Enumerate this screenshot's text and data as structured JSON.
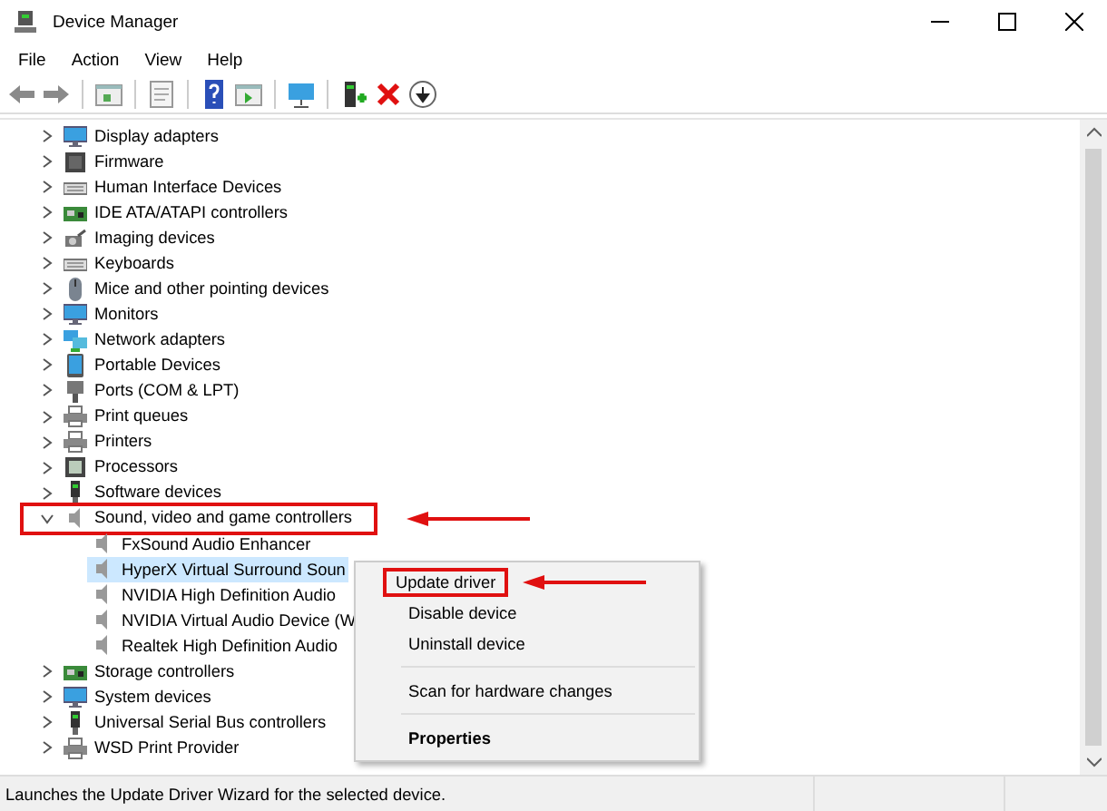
{
  "window": {
    "title": "Device Manager"
  },
  "menu": [
    "File",
    "Action",
    "View",
    "Help"
  ],
  "tree": [
    {
      "label": "Display adapters",
      "expanded": false
    },
    {
      "label": "Firmware",
      "expanded": false
    },
    {
      "label": "Human Interface Devices",
      "expanded": false
    },
    {
      "label": "IDE ATA/ATAPI controllers",
      "expanded": false
    },
    {
      "label": "Imaging devices",
      "expanded": false
    },
    {
      "label": "Keyboards",
      "expanded": false
    },
    {
      "label": "Mice and other pointing devices",
      "expanded": false
    },
    {
      "label": "Monitors",
      "expanded": false
    },
    {
      "label": "Network adapters",
      "expanded": false
    },
    {
      "label": "Portable Devices",
      "expanded": false
    },
    {
      "label": "Ports (COM & LPT)",
      "expanded": false
    },
    {
      "label": "Print queues",
      "expanded": false
    },
    {
      "label": "Printers",
      "expanded": false
    },
    {
      "label": "Processors",
      "expanded": false
    },
    {
      "label": "Software devices",
      "expanded": false
    },
    {
      "label": "Sound, video and game controllers",
      "expanded": true,
      "highlighted": true,
      "children": [
        {
          "label": "FxSound Audio Enhancer",
          "selected": false
        },
        {
          "label": "HyperX Virtual Surround Soun",
          "selected": true
        },
        {
          "label": "NVIDIA High Definition Audio",
          "selected": false
        },
        {
          "label": "NVIDIA Virtual Audio Device (W",
          "selected": false
        },
        {
          "label": "Realtek High Definition Audio",
          "selected": false
        }
      ]
    },
    {
      "label": "Storage controllers",
      "expanded": false
    },
    {
      "label": "System devices",
      "expanded": false
    },
    {
      "label": "Universal Serial Bus controllers",
      "expanded": false
    },
    {
      "label": "WSD Print Provider",
      "expanded": false
    }
  ],
  "context_menu": [
    {
      "kind": "item",
      "label": "Update driver",
      "highlighted": true
    },
    {
      "kind": "item",
      "label": "Disable device",
      "highlighted": false
    },
    {
      "kind": "item",
      "label": "Uninstall device",
      "highlighted": false
    },
    {
      "kind": "separator"
    },
    {
      "kind": "item",
      "label": "Scan for hardware changes",
      "highlighted": false
    },
    {
      "kind": "separator"
    },
    {
      "kind": "default",
      "label": "Properties",
      "highlighted": false
    }
  ],
  "status_bar": "Launches the Update Driver Wizard for the selected device."
}
